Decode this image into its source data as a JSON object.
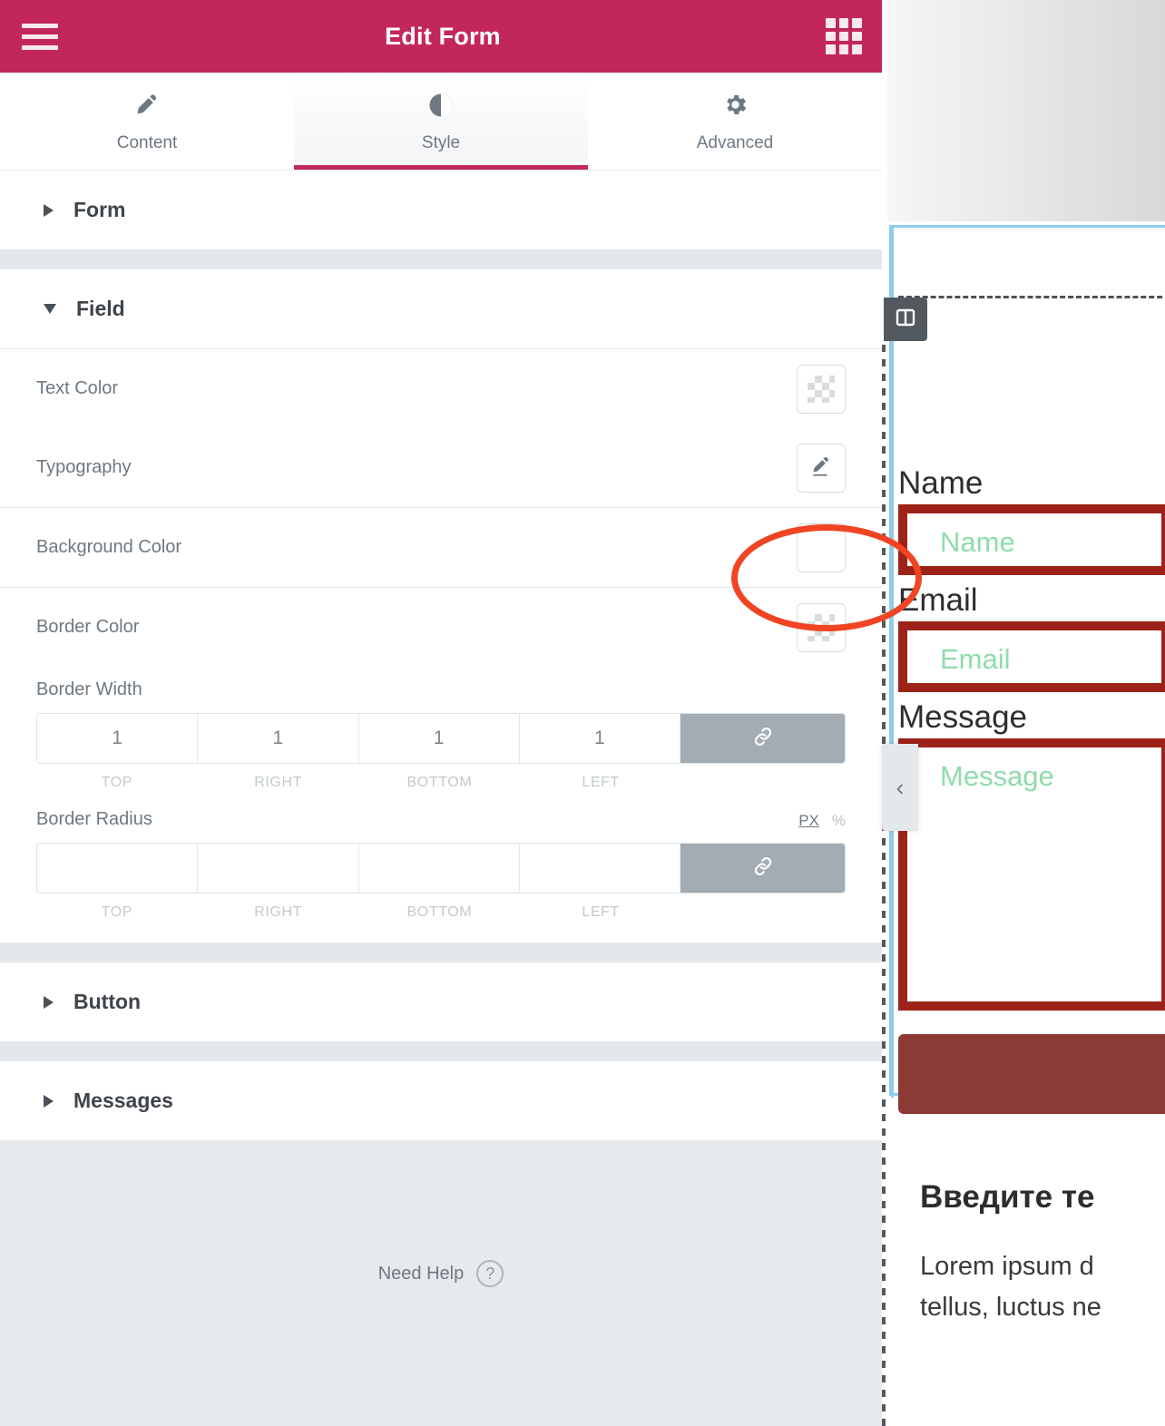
{
  "header": {
    "title": "Edit Form",
    "menu_icon": "hamburger-icon",
    "apps_icon": "grid-apps-icon",
    "brand_color": "#c2275c"
  },
  "tabs": [
    {
      "label": "Content",
      "icon": "pencil-icon",
      "active": false
    },
    {
      "label": "Style",
      "icon": "contrast-icon",
      "active": true
    },
    {
      "label": "Advanced",
      "icon": "gear-icon",
      "active": false
    }
  ],
  "sections": {
    "form": {
      "label": "Form",
      "expanded": false,
      "caret": "caret-right-icon"
    },
    "field": {
      "label": "Field",
      "expanded": true,
      "caret": "caret-down-icon"
    },
    "button": {
      "label": "Button",
      "expanded": false,
      "caret": "caret-right-icon"
    },
    "messages": {
      "label": "Messages",
      "expanded": false,
      "caret": "caret-right-icon"
    }
  },
  "field_controls": {
    "text_color": {
      "label": "Text Color",
      "value": "",
      "swatch": "transparent-checker-icon"
    },
    "typography": {
      "label": "Typography",
      "edit_icon": "pencil-edit-icon"
    },
    "background_color": {
      "label": "Background Color",
      "value": "",
      "swatch": "empty-swatch-icon",
      "highlighted": true
    },
    "border_color": {
      "label": "Border Color",
      "value": "",
      "swatch": "transparent-checker-icon"
    },
    "border_width": {
      "label": "Border Width",
      "values": [
        "1",
        "1",
        "1",
        "1"
      ],
      "sides": [
        "TOP",
        "RIGHT",
        "BOTTOM",
        "LEFT"
      ],
      "link_icon": "link-icon",
      "linked": true
    },
    "border_radius": {
      "label": "Border Radius",
      "values": [
        "",
        "",
        "",
        ""
      ],
      "sides": [
        "TOP",
        "RIGHT",
        "BOTTOM",
        "LEFT"
      ],
      "units": [
        {
          "label": "PX",
          "active": true
        },
        {
          "label": "%",
          "active": false
        }
      ],
      "link_icon": "link-icon",
      "linked": true
    }
  },
  "footer": {
    "need_help": "Need Help",
    "help_icon": "question-mark-icon"
  },
  "preview": {
    "column_handle_icon": "column-layout-icon",
    "collapse_arrow": "‹",
    "fields": [
      {
        "label": "Name",
        "placeholder": "Name",
        "type": "input"
      },
      {
        "label": "Email",
        "placeholder": "Email",
        "type": "input"
      },
      {
        "label": "Message",
        "placeholder": "Message",
        "type": "textarea"
      }
    ],
    "submit_label": "",
    "heading": "Введите те",
    "paragraph_line1": "Lorem ipsum d",
    "paragraph_line2": "tellus, luctus ne",
    "field_border_color": "#9d2318",
    "placeholder_color": "#8fdcab",
    "submit_color": "#8c3a35",
    "selection_color": "#8ecdea"
  },
  "annotation": {
    "shape": "ellipse",
    "color": "#f04423",
    "target": "background-color-swatch"
  }
}
